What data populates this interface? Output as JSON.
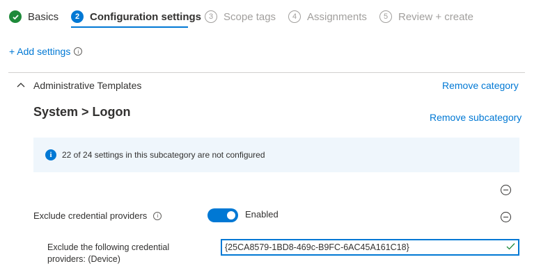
{
  "wizard": {
    "steps": [
      {
        "number": "",
        "label": "Basics",
        "state": "done"
      },
      {
        "number": "2",
        "label": "Configuration settings",
        "state": "active"
      },
      {
        "number": "3",
        "label": "Scope tags",
        "state": "pending"
      },
      {
        "number": "4",
        "label": "Assignments",
        "state": "pending"
      },
      {
        "number": "5",
        "label": "Review + create",
        "state": "pending"
      }
    ]
  },
  "toolbar": {
    "add_settings": "+ Add settings"
  },
  "category": {
    "title": "Administrative Templates",
    "remove_label": "Remove category"
  },
  "subcategory": {
    "title": "System > Logon",
    "remove_label": "Remove subcategory",
    "info_text": "22 of 24 settings in this subcategory are not configured"
  },
  "setting": {
    "label": "Exclude credential providers",
    "toggle_label": "Enabled",
    "enabled": true,
    "field_label": "Exclude the following credential providers: (Device)",
    "field_value": "{25CA8579-1BD8-469c-B9FC-6AC45A161C18}"
  },
  "colors": {
    "accent": "#0078d4",
    "success": "#1e8a3a",
    "info_background": "#eff6fc"
  }
}
